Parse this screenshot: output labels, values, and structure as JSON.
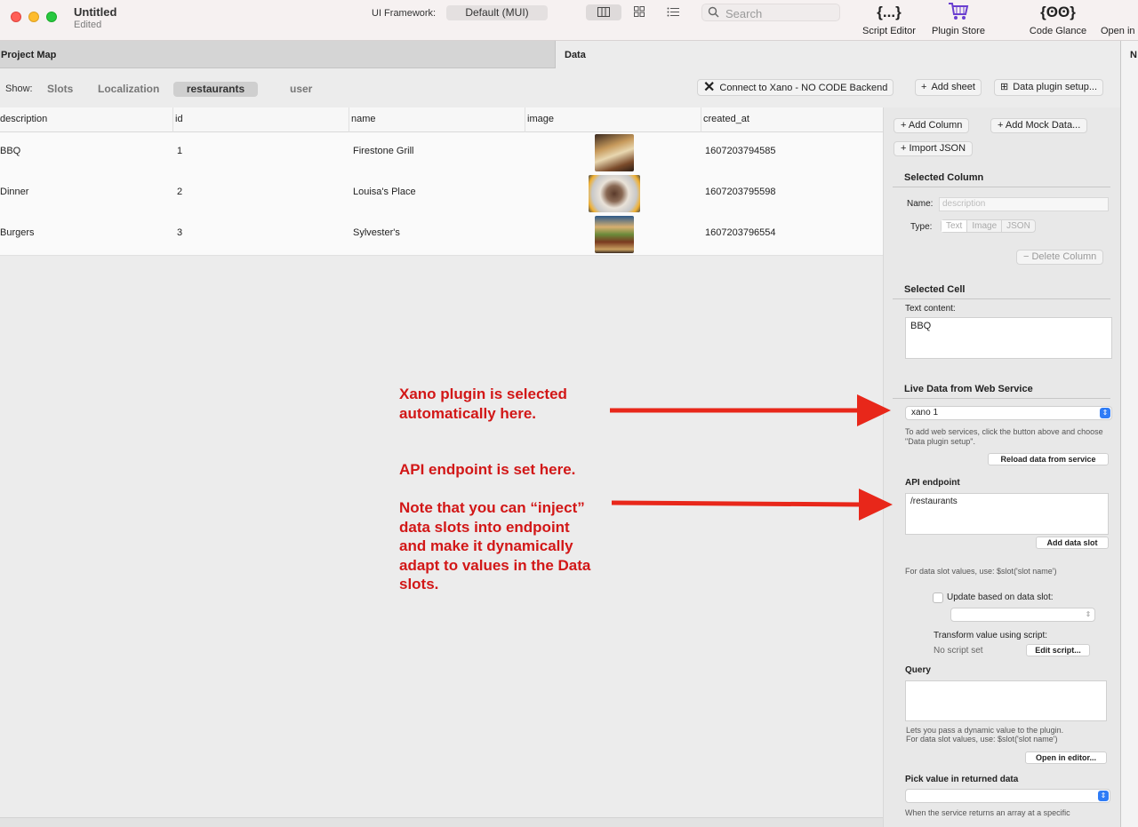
{
  "window": {
    "title": "Untitled",
    "subtitle": "Edited"
  },
  "toolbar": {
    "framework_label": "UI Framework:",
    "framework_value": "Default (MUI)",
    "search_placeholder": "Search",
    "script_editor": "Script Editor",
    "plugin_store": "Plugin Store",
    "code_glance": "Code Glance",
    "open_in": "Open in",
    "script_icon": "{...}",
    "glance_icon": "{ʘʘ}"
  },
  "panels": {
    "left": "Project Map",
    "right": "Data",
    "edge": "N"
  },
  "show": {
    "label": "Show:",
    "items": [
      "Slots",
      "Localization",
      "restaurants",
      "user"
    ],
    "active": "restaurants"
  },
  "actions": {
    "xano": "Connect to Xano - NO CODE Backend",
    "add_sheet": "Add sheet",
    "plugin_setup": "Data plugin setup..."
  },
  "table": {
    "columns": [
      "description",
      "id",
      "name",
      "image",
      "created_at"
    ],
    "rows": [
      {
        "description": "BBQ",
        "id": "1",
        "name": "Firestone Grill",
        "created_at": "1607203794585"
      },
      {
        "description": "Dinner",
        "id": "2",
        "name": "Louisa's Place",
        "created_at": "1607203795598"
      },
      {
        "description": "Burgers",
        "id": "3",
        "name": "Sylvester's",
        "created_at": "1607203796554"
      }
    ]
  },
  "sidebar": {
    "add_column": "Add Column",
    "add_mock": "Add Mock Data...",
    "import_json": "Import JSON",
    "selected_column": "Selected Column",
    "name_label": "Name:",
    "name_placeholder": "description",
    "type_label": "Type:",
    "types": [
      "Text",
      "Image",
      "JSON"
    ],
    "delete_column": "Delete Column",
    "selected_cell": "Selected Cell",
    "text_content_label": "Text content:",
    "text_content": "BBQ",
    "live_data": "Live Data from Web Service",
    "service": "xano 1",
    "service_note": "To add web services, click the button above and choose \"Data plugin setup\".",
    "reload": "Reload data from service",
    "api_label": "API endpoint",
    "api_value": "/restaurants",
    "add_slot": "Add data slot",
    "slot_note": "For data slot values, use: $slot('slot name')",
    "update_label": "Update based on data slot:",
    "transform_label": "Transform value using script:",
    "no_script": "No script set",
    "edit_script": "Edit script...",
    "query_label": "Query",
    "query_note_1": "Lets you pass a dynamic value to the plugin.",
    "query_note_2": "For data slot values, use: $slot('slot name')",
    "open_editor": "Open in editor...",
    "pick_label": "Pick value in returned data",
    "pick_note": "When the service returns an array at a specific"
  },
  "annotations": {
    "a1": "Xano plugin is selected automatically here.",
    "a2": "API endpoint is set here.",
    "a3": "Note that you can “inject” data slots into endpoint and make it dynamically adapt to values in the Data slots."
  },
  "colors": {
    "annotation": "#d21717",
    "accent": "#2f7cf6",
    "plugin_store": "#6a3fd0"
  }
}
